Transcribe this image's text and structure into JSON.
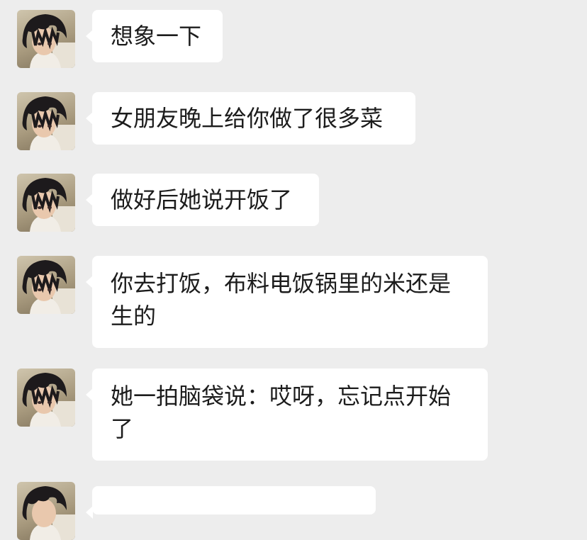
{
  "chat": {
    "messages": [
      {
        "text": "想象一下",
        "avatar_icon": "anime-boy-avatar-icon"
      },
      {
        "text": "女朋友晚上给你做了很多菜",
        "avatar_icon": "anime-boy-avatar-icon"
      },
      {
        "text": "做好后她说开饭了",
        "avatar_icon": "anime-boy-avatar-icon"
      },
      {
        "text": "你去打饭，布料电饭锅里的米还是生的",
        "avatar_icon": "anime-boy-avatar-icon"
      },
      {
        "text": "她一拍脑袋说：哎呀，忘记点开始了",
        "avatar_icon": "anime-boy-avatar-icon"
      },
      {
        "text": "",
        "avatar_icon": "anime-boy-avatar-icon"
      }
    ]
  },
  "colors": {
    "background": "#ededed",
    "bubble": "#ffffff",
    "text": "#1c1c1c"
  }
}
